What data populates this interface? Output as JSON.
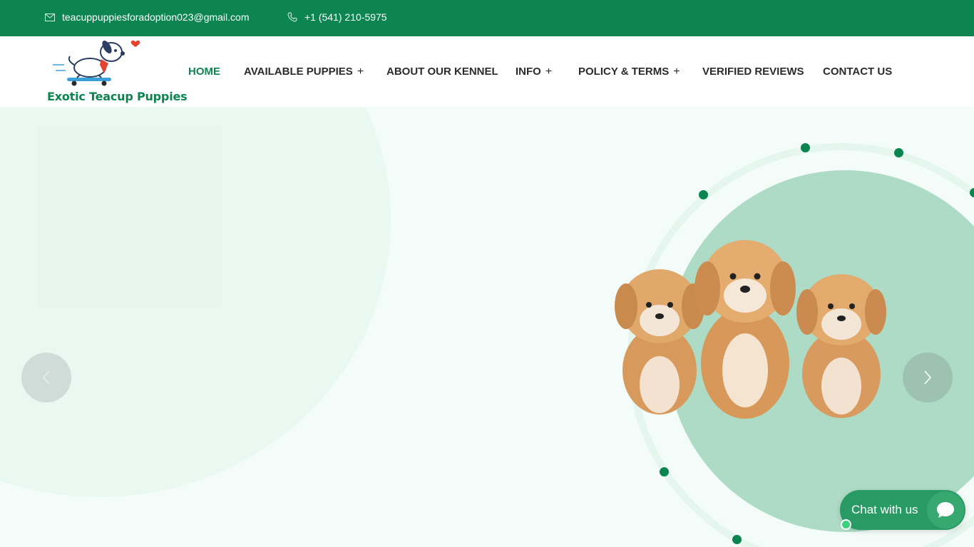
{
  "topbar": {
    "email": "teacuppuppiesforadoption023@gmail.com",
    "phone": "+1 (541) 210-5975",
    "email_icon": "envelope-icon",
    "phone_icon": "phone-icon"
  },
  "brand": {
    "name": "Exotic Teacup Puppies",
    "logo_icon": "dog-on-skateboard-icon"
  },
  "nav": {
    "items": [
      {
        "label": "HOME",
        "active": true,
        "has_submenu": false
      },
      {
        "label": "AVAILABLE PUPPIES",
        "active": false,
        "has_submenu": true
      },
      {
        "label": "ABOUT OUR KENNEL",
        "active": false,
        "has_submenu": false
      },
      {
        "label": "INFO",
        "active": false,
        "has_submenu": true
      },
      {
        "label": "POLICY & TERMS",
        "active": false,
        "has_submenu": true
      },
      {
        "label": "VERIFIED REVIEWS",
        "active": false,
        "has_submenu": false
      },
      {
        "label": "CONTACT US",
        "active": false,
        "has_submenu": false
      }
    ],
    "submenu_glyph": "+"
  },
  "hero": {
    "image": "three-apricot-puppies",
    "prev_icon": "chevron-left-icon",
    "next_icon": "chevron-right-icon"
  },
  "chat": {
    "label": "Chat with us",
    "icon": "speech-bubble-icon"
  },
  "colors": {
    "brand_green": "#0c8551",
    "hero_blob": "#addbc6",
    "hero_background": "#f4fcf9"
  }
}
